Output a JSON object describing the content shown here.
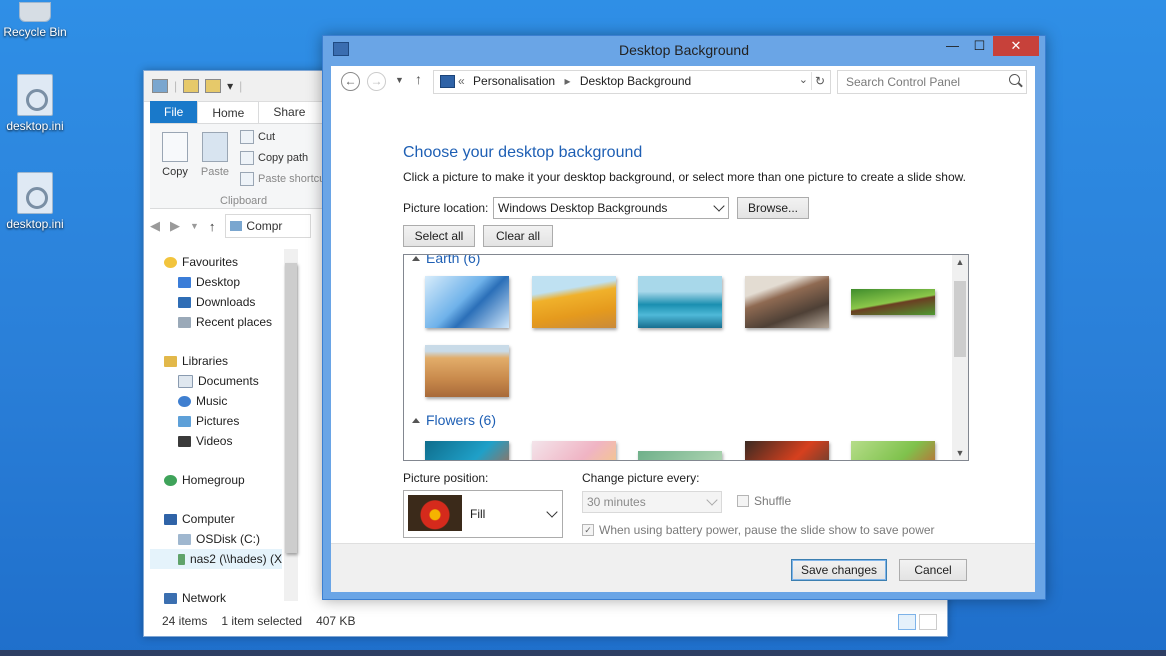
{
  "desktop": {
    "icons": [
      {
        "label": "Recycle Bin"
      },
      {
        "label": "desktop.ini"
      },
      {
        "label": "desktop.ini"
      }
    ]
  },
  "explorer": {
    "tabs": {
      "file": "File",
      "home": "Home",
      "share": "Share"
    },
    "ribbon": {
      "copy": "Copy",
      "paste": "Paste",
      "cut": "Cut",
      "copy_path": "Copy path",
      "paste_shortcut": "Paste shortcut",
      "group_label": "Clipboard"
    },
    "address_partial": "Compr",
    "nav": {
      "favourites": "Favourites",
      "desktop": "Desktop",
      "downloads": "Downloads",
      "recent": "Recent places",
      "libraries": "Libraries",
      "documents": "Documents",
      "music": "Music",
      "pictures": "Pictures",
      "videos": "Videos",
      "homegroup": "Homegroup",
      "computer": "Computer",
      "osdisk": "OSDisk (C:)",
      "nas2": "nas2 (\\\\hades) (X",
      "network": "Network"
    },
    "status": {
      "items": "24 items",
      "selected": "1 item selected",
      "size": "407 KB"
    }
  },
  "dialog": {
    "title": "Desktop Background",
    "caption": {
      "minimize": "—",
      "maximize": "☐",
      "close": "✕"
    },
    "breadcrumb": {
      "prefix": "«",
      "parent": "Personalisation",
      "current": "Desktop Background"
    },
    "search_placeholder": "Search Control Panel",
    "heading": "Choose your desktop background",
    "description": "Click a picture to make it your desktop background, or select more than one picture to create a slide show.",
    "picture_location_label": "Picture location:",
    "picture_location_value": "Windows Desktop Backgrounds",
    "browse": "Browse...",
    "select_all": "Select all",
    "clear_all": "Clear all",
    "groups": [
      {
        "name": "Earth (6)"
      },
      {
        "name": "Flowers (6)"
      }
    ],
    "picture_position_label": "Picture position:",
    "picture_position_value": "Fill",
    "change_every_label": "Change picture every:",
    "change_every_value": "30 minutes",
    "shuffle": "Shuffle",
    "battery": "When using battery power, pause the slide show to save power",
    "save": "Save changes",
    "cancel": "Cancel"
  },
  "colors": {
    "accent": "#1e5fb4",
    "frame": "#6aa5e6",
    "close": "#c7413a"
  }
}
